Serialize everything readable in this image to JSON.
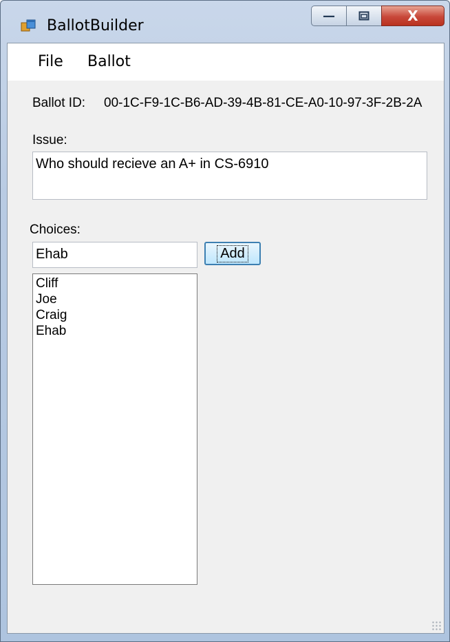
{
  "window": {
    "title": "BallotBuilder",
    "minimize_glyph": "—",
    "maximize_glyph": "▫",
    "close_glyph": "X",
    "icon": "app-window-icon"
  },
  "menu": [
    {
      "label": "File"
    },
    {
      "label": "Ballot"
    }
  ],
  "form": {
    "ballot_id_label": "Ballot ID:",
    "ballot_id_value": "00-1C-F9-1C-B6-AD-39-4B-81-CE-A0-10-97-3F-2B-2A",
    "issue_label": "Issue:",
    "issue_value": "Who should recieve an A+ in CS-6910",
    "choices_label": "Choices:",
    "choice_input_value": "Ehab",
    "add_label": "Add",
    "choices": [
      "Cliff",
      "Joe",
      "Craig",
      "Ehab"
    ]
  },
  "colors": {
    "close_button": "#c8483a",
    "titlebar": "#b9cbe3",
    "add_button_border": "#3c7fb1"
  }
}
